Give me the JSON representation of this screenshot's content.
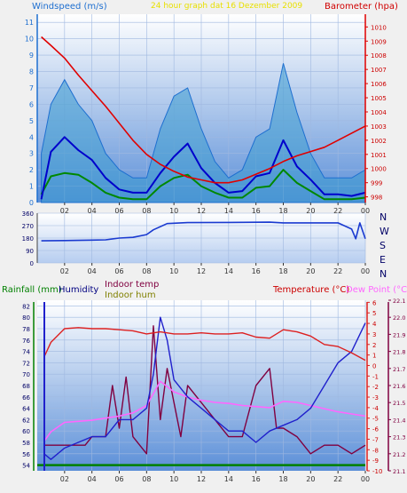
{
  "header": {
    "left_label": "Windspeed (m/s)",
    "center_label": "24 hour graph dat 16 Dezember 2009",
    "right_label": "Barometer (hpa)"
  },
  "mid": {
    "compass_letters": [
      "N",
      "W",
      "S",
      "E",
      "N"
    ]
  },
  "bottom": {
    "rainfall_label": "Rainfall (mm)",
    "humidity_label": "Humidity",
    "indoor_temp_label": "Indoor temp",
    "indoor_hum_label": "Indoor hum",
    "temperature_label": "Temperature (°C)",
    "dew_point_label": "Dew Point (°C)"
  },
  "colors": {
    "wind": "#1e6fd0",
    "wind_avg": "#0000cc",
    "wind_green": "#008800",
    "barometer": "#e00000",
    "direction": "#1a3ad0",
    "humidity": "#2020cc",
    "temperature": "#dd2020",
    "dew_point": "#ff66ff",
    "indoor_temp": "#800040",
    "indoor_hum": "#808000",
    "rain": "#008000"
  },
  "chart_data": [
    {
      "type": "line",
      "title": "24 hour graph dat 16 Dezember 2009",
      "x_ticks": [
        "02",
        "04",
        "06",
        "08",
        "10",
        "12",
        "14",
        "16",
        "18",
        "20",
        "22",
        "00"
      ],
      "left_axis": {
        "label": "Windspeed (m/s)",
        "ticks": [
          0,
          1,
          2,
          3,
          4,
          5,
          6,
          7,
          8,
          9,
          10,
          11
        ],
        "range": [
          0,
          11.5
        ]
      },
      "right_axis": {
        "label": "Barometer (hpa)",
        "ticks": [
          998,
          999,
          1000,
          1001,
          1002,
          1003,
          1004,
          1005,
          1006,
          1007,
          1008,
          1009,
          1010
        ],
        "range": [
          997.6,
          1010.9
        ]
      },
      "series": [
        {
          "name": "Barometer (hpa)",
          "axis": "right",
          "x": [
            0.3,
            1,
            2,
            3,
            4,
            5,
            6,
            7,
            8,
            9,
            10,
            11,
            12,
            13,
            14,
            15,
            16,
            17,
            18,
            19,
            20,
            21,
            22,
            23,
            24
          ],
          "values": [
            1009.3,
            1008.7,
            1007.8,
            1006.6,
            1005.5,
            1004.4,
            1003.2,
            1002.0,
            1001.0,
            1000.3,
            999.8,
            999.4,
            999.2,
            999.0,
            999.0,
            999.2,
            999.6,
            1000.0,
            1000.5,
            1000.9,
            1001.2,
            1001.5,
            1002.0,
            1002.5,
            1003.0
          ]
        },
        {
          "name": "Windspeed (m/s) avg",
          "axis": "left",
          "x": [
            0.3,
            1,
            2,
            3,
            4,
            5,
            6,
            7,
            8,
            9,
            10,
            11,
            12,
            13,
            14,
            15,
            16,
            17,
            18,
            19,
            20,
            21,
            22,
            23,
            24
          ],
          "values": [
            0.2,
            3.1,
            4.0,
            3.2,
            2.6,
            1.5,
            0.8,
            0.6,
            0.6,
            1.8,
            2.8,
            3.6,
            2.1,
            1.2,
            0.6,
            0.7,
            1.6,
            1.8,
            3.8,
            2.2,
            1.4,
            0.5,
            0.5,
            0.4,
            0.6
          ]
        },
        {
          "name": "Windspeed (m/s) gust",
          "axis": "left",
          "x": [
            0.3,
            1,
            2,
            3,
            4,
            5,
            6,
            7,
            8,
            9,
            10,
            11,
            12,
            13,
            14,
            15,
            16,
            17,
            18,
            19,
            20,
            21,
            22,
            23,
            24
          ],
          "values": [
            3.0,
            6.0,
            7.5,
            6.0,
            5.0,
            3.0,
            2.0,
            1.5,
            1.5,
            4.5,
            6.5,
            7.0,
            4.5,
            2.5,
            1.5,
            2.0,
            4.0,
            4.5,
            8.5,
            5.5,
            3.0,
            1.5,
            1.5,
            1.5,
            2.0
          ]
        },
        {
          "name": "Windspeed (m/s) min",
          "axis": "left",
          "x": [
            0.3,
            1,
            2,
            3,
            4,
            5,
            6,
            7,
            8,
            9,
            10,
            11,
            12,
            13,
            14,
            15,
            16,
            17,
            18,
            19,
            20,
            21,
            22,
            23,
            24
          ],
          "values": [
            0.5,
            1.6,
            1.8,
            1.7,
            1.2,
            0.6,
            0.3,
            0.2,
            0.2,
            1.0,
            1.5,
            1.7,
            1.0,
            0.6,
            0.3,
            0.3,
            0.9,
            1.0,
            2.0,
            1.2,
            0.7,
            0.2,
            0.2,
            0.2,
            0.3
          ]
        }
      ]
    },
    {
      "type": "line",
      "x_ticks": [
        "02",
        "04",
        "06",
        "08",
        "10",
        "12",
        "14",
        "16",
        "18",
        "20",
        "22",
        "00"
      ],
      "left_axis": {
        "ticks": [
          0,
          90,
          180,
          270,
          360
        ],
        "range": [
          0,
          360
        ]
      },
      "series": [
        {
          "name": "Wind direction",
          "x": [
            0.3,
            2,
            4,
            5,
            6,
            7,
            8,
            8.5,
            9.5,
            11,
            14,
            17,
            18,
            19,
            20,
            21,
            22,
            23,
            23.3,
            23.6,
            24
          ],
          "values": [
            160,
            162,
            165,
            167,
            180,
            185,
            205,
            240,
            285,
            292,
            293,
            295,
            290,
            290,
            290,
            290,
            290,
            245,
            175,
            290,
            175
          ]
        }
      ]
    },
    {
      "type": "line",
      "x_ticks": [
        "02",
        "04",
        "06",
        "08",
        "10",
        "12",
        "14",
        "16",
        "18",
        "20",
        "22",
        "00"
      ],
      "left_axis": {
        "label": "Humidity",
        "ticks": [
          54,
          56,
          58,
          60,
          62,
          64,
          66,
          68,
          70,
          72,
          74,
          76,
          78,
          80,
          82
        ],
        "range": [
          53,
          83
        ]
      },
      "right_axis_temperature": {
        "label": "Temperature (°C)",
        "ticks": [
          -10,
          -9,
          -8,
          -7,
          -6,
          -5,
          -4,
          -3,
          -2,
          -1,
          0,
          1,
          2,
          3,
          4,
          5,
          6
        ],
        "range": [
          -10,
          6.2
        ]
      },
      "right_axis_indoor": {
        "label": "Indoor temp",
        "ticks": [
          21.1,
          21.2,
          21.3,
          21.4,
          21.5,
          21.6,
          21.7,
          21.8,
          21.9,
          22.0,
          22.1
        ],
        "range": [
          21.1,
          22.1
        ]
      },
      "series": [
        {
          "name": "Humidity",
          "axis": "left",
          "x": [
            0.5,
            1,
            2,
            3,
            4,
            5,
            6,
            7,
            7.5,
            8,
            8.5,
            9,
            9.5,
            10,
            11,
            12,
            13,
            14,
            15,
            16,
            17,
            18,
            19,
            20,
            21,
            22,
            23,
            24
          ],
          "values": [
            56,
            55,
            57,
            58,
            59,
            59,
            62,
            62,
            63,
            64,
            70,
            80,
            76,
            69,
            66,
            64,
            62,
            60,
            60,
            58,
            60,
            61,
            62,
            64,
            68,
            72,
            74,
            79
          ]
        },
        {
          "name": "Temperature (°C)",
          "axis": "temperature",
          "x": [
            0.5,
            1,
            2,
            3,
            4,
            5,
            6,
            7,
            8,
            9,
            10,
            11,
            12,
            13,
            14,
            15,
            16,
            17,
            18,
            19,
            20,
            21,
            22,
            23,
            24
          ],
          "values": [
            0.8,
            2.2,
            3.5,
            3.6,
            3.5,
            3.5,
            3.4,
            3.3,
            3.0,
            3.2,
            3.0,
            3.0,
            3.1,
            3.0,
            3.0,
            3.1,
            2.7,
            2.6,
            3.4,
            3.2,
            2.8,
            2.0,
            1.8,
            1.2,
            0.5
          ]
        },
        {
          "name": "Dew Point (°C)",
          "axis": "temperature",
          "x": [
            0.5,
            1,
            2,
            3,
            4,
            5,
            6,
            7,
            8,
            9,
            10,
            11,
            12,
            13,
            14,
            15,
            16,
            17,
            18,
            19,
            20,
            21,
            22,
            23,
            24
          ],
          "values": [
            -7.2,
            -6.3,
            -5.4,
            -5.3,
            -5.2,
            -5.0,
            -4.8,
            -4.5,
            -3.8,
            -1.5,
            -2.5,
            -3.0,
            -3.3,
            -3.5,
            -3.6,
            -3.8,
            -3.9,
            -4.0,
            -3.4,
            -3.5,
            -3.8,
            -4.1,
            -4.4,
            -4.6,
            -4.8
          ]
        },
        {
          "name": "Indoor temp",
          "axis": "indoor",
          "x": [
            0.5,
            2,
            3.5,
            4,
            5,
            5.5,
            6,
            6.5,
            7,
            8,
            8.5,
            9,
            9.5,
            10,
            10.5,
            11,
            12,
            13,
            14,
            15,
            16,
            17,
            17.5,
            18,
            19,
            20,
            21,
            22,
            23,
            24
          ],
          "values": [
            21.25,
            21.25,
            21.25,
            21.3,
            21.3,
            21.6,
            21.35,
            21.65,
            21.3,
            21.2,
            21.95,
            21.4,
            21.7,
            21.5,
            21.3,
            21.6,
            21.5,
            21.4,
            21.3,
            21.3,
            21.6,
            21.7,
            21.35,
            21.35,
            21.3,
            21.2,
            21.25,
            21.25,
            21.2,
            21.25
          ]
        },
        {
          "name": "Rainfall (mm)",
          "axis": "left",
          "x": [
            0,
            24
          ],
          "values": [
            54,
            54
          ]
        }
      ]
    }
  ]
}
